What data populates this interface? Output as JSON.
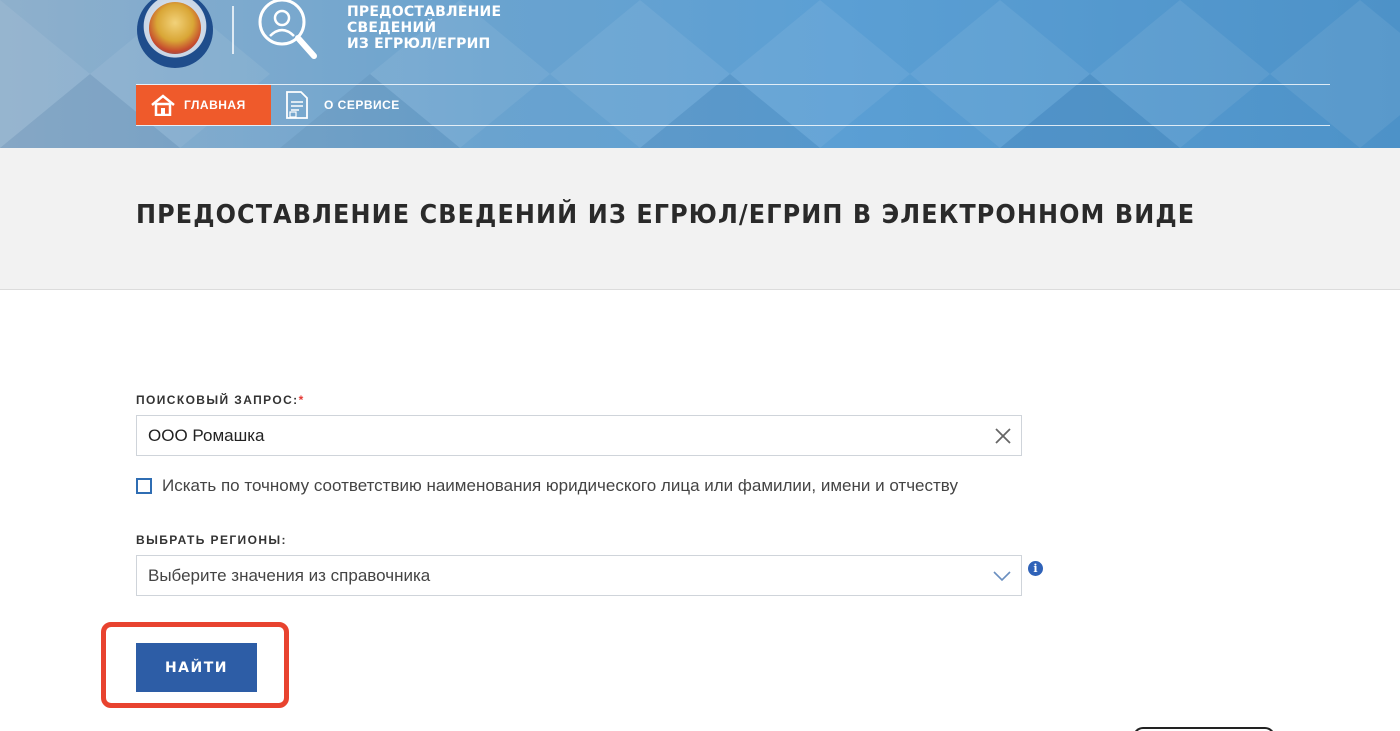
{
  "header": {
    "logo_lines": [
      "ПРЕДОСТАВЛЕНИЕ",
      "СВЕДЕНИЙ",
      "ИЗ ЕГРЮЛ/ЕГРИП"
    ],
    "nav": [
      {
        "label": "ГЛАВНАЯ",
        "icon": "home-icon",
        "active": true
      },
      {
        "label": "О СЕРВИСЕ",
        "icon": "document-icon",
        "active": false
      }
    ],
    "accent_color": "#ef5a2b"
  },
  "page": {
    "title": "ПРЕДОСТАВЛЕНИЕ СВЕДЕНИЙ ИЗ ЕГРЮЛ/ЕГРИП В ЭЛЕКТРОННОМ ВИДЕ"
  },
  "form": {
    "search_label": "ПОИСКОВЫЙ ЗАПРОС:",
    "required_mark": "*",
    "search_value": "ООО Ромашка",
    "exact_match_label": "Искать по точному соответствию наименования юридического лица или фамилии, имени и отчеству",
    "exact_match_checked": false,
    "regions_label": "ВЫБРАТЬ РЕГИОНЫ:",
    "regions_placeholder": "Выберите значения из справочника",
    "info_icon_glyph": "i",
    "find_button_label": "НАЙТИ",
    "button_color": "#2d5da6",
    "highlight_color": "#e8432f"
  }
}
